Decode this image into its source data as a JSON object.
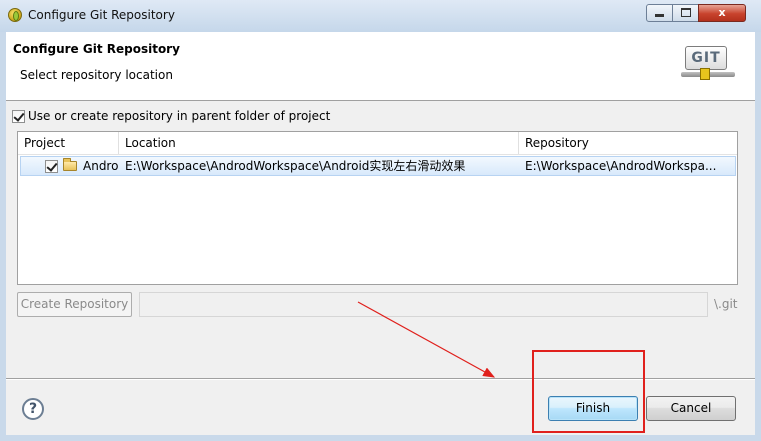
{
  "window": {
    "title": "Configure Git Repository",
    "close_glyph": "x"
  },
  "header": {
    "title": "Configure Git Repository",
    "subtitle": "Select repository location",
    "logo_text": "GIT"
  },
  "parent_folder_option": {
    "label": "Use or create repository in parent folder of project",
    "checked": true
  },
  "table": {
    "columns": [
      "Project",
      "Location",
      "Repository"
    ],
    "rows": [
      {
        "checked": true,
        "icon": "folder-icon",
        "project": "Andro",
        "location": "E:\\Workspace\\AndrodWorkspace\\Android实现左右滑动效果",
        "repository": "E:\\Workspace\\AndrodWorkspa..."
      }
    ]
  },
  "create_repository": {
    "button_label": "Create Repository",
    "path_value": "",
    "suffix": "\\.git"
  },
  "footer": {
    "help_glyph": "?",
    "finish_label": "Finish",
    "cancel_label": "Cancel"
  },
  "annotation_color": "#e0201c"
}
